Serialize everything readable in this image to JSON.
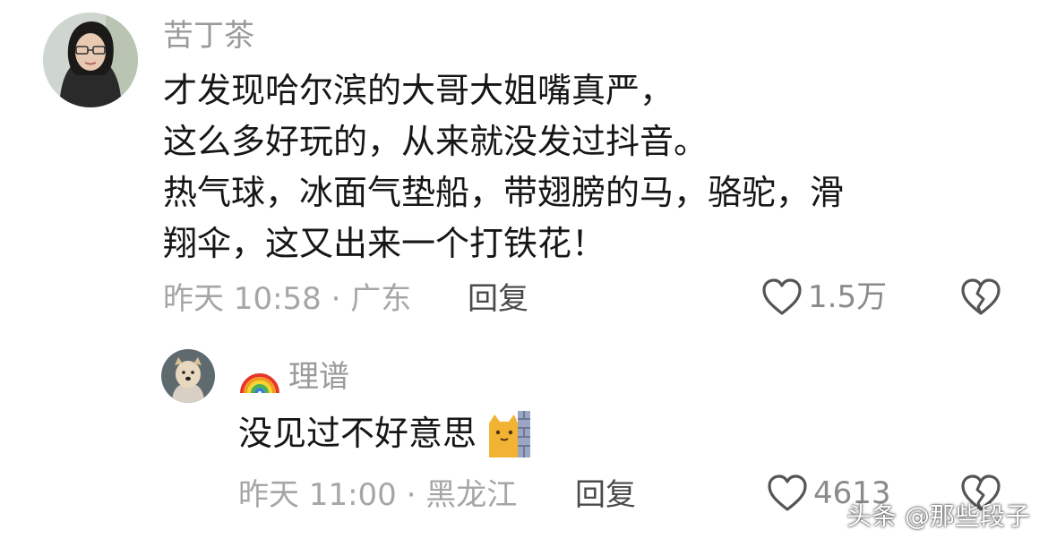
{
  "comment": {
    "username": "苦丁茶",
    "lines": [
      "才发现哈尔滨的大哥大姐嘴真严，",
      "这么多好玩的，从来就没发过抖音。",
      "热气球，冰面气垫船，带翅膀的马，骆驼，滑",
      "翔伞，这又出来一个打铁花！"
    ],
    "time_location": "昨天 10:58 · 广东",
    "reply_label": "回复",
    "likes": "1.5万",
    "avatar_icon": "person-photo-icon"
  },
  "reply": {
    "username_emoji": "🌈",
    "username": "理谱",
    "text": "没见过不好意思",
    "text_emoji_icon": "cat-behind-wall-icon",
    "time_location": "昨天 11:00 · 黑龙江",
    "reply_label": "回复",
    "likes": "4613",
    "avatar_icon": "dog-photo-icon"
  },
  "watermark": "头条 @那些段子",
  "colors": {
    "muted_text": "#a6a6a6",
    "icon_stroke": "#555555",
    "text": "#161616"
  }
}
